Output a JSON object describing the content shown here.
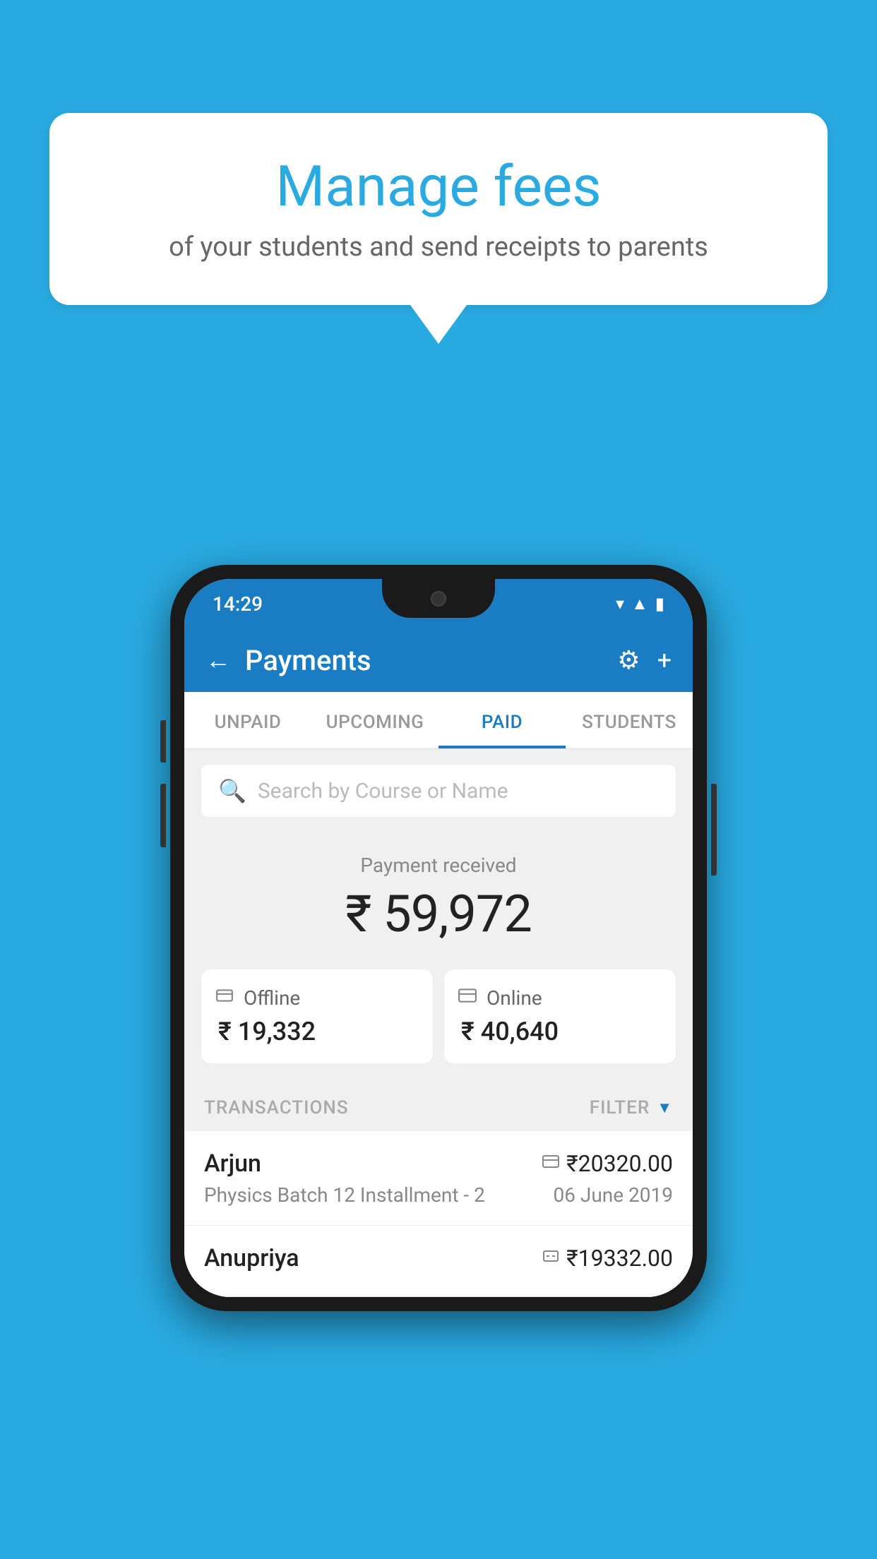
{
  "background_color": "#29abe2",
  "speech_bubble": {
    "title": "Manage fees",
    "subtitle": "of your students and send receipts to parents"
  },
  "phone": {
    "status_bar": {
      "time": "14:29",
      "icons": [
        "wifi",
        "signal",
        "battery"
      ]
    },
    "header": {
      "back_label": "←",
      "title": "Payments",
      "gear_icon": "⚙",
      "plus_icon": "+"
    },
    "tabs": [
      {
        "label": "UNPAID",
        "active": false
      },
      {
        "label": "UPCOMING",
        "active": false
      },
      {
        "label": "PAID",
        "active": true
      },
      {
        "label": "STUDENTS",
        "active": false
      }
    ],
    "search": {
      "placeholder": "Search by Course or Name"
    },
    "payment_section": {
      "label": "Payment received",
      "amount": "₹ 59,972",
      "offline": {
        "icon": "💳",
        "label": "Offline",
        "amount": "₹ 19,332"
      },
      "online": {
        "icon": "💳",
        "label": "Online",
        "amount": "₹ 40,640"
      }
    },
    "transactions": {
      "label": "TRANSACTIONS",
      "filter_label": "FILTER",
      "items": [
        {
          "name": "Arjun",
          "course": "Physics Batch 12 Installment - 2",
          "amount": "₹20320.00",
          "date": "06 June 2019",
          "payment_type": "online"
        },
        {
          "name": "Anupriya",
          "course": "",
          "amount": "₹19332.00",
          "date": "",
          "payment_type": "offline"
        }
      ]
    }
  }
}
